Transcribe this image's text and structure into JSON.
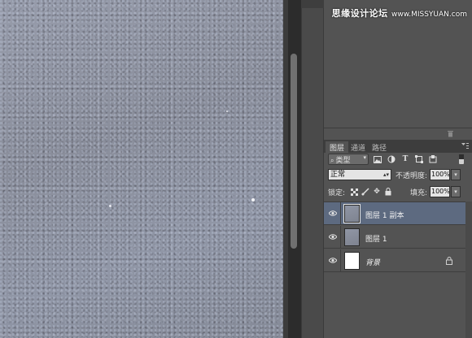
{
  "watermark": {
    "site_name": "思缘设计论坛",
    "url": "www.MISSYUAN.com"
  },
  "canvas": {
    "description": "gray-blue concrete texture"
  },
  "layers_panel": {
    "tabs": [
      "图层",
      "通道",
      "路径"
    ],
    "active_tab_index": 0,
    "filter": {
      "kind_label": "类型",
      "icons": [
        "image-filter-icon",
        "adjustment-filter-icon",
        "type-filter-icon",
        "shape-filter-icon",
        "smart-object-filter-icon"
      ]
    },
    "blend_mode": "正常",
    "opacity_label": "不透明度:",
    "opacity_value": "100%",
    "lock_label": "锁定:",
    "fill_label": "填充:",
    "fill_value": "100%",
    "layers": [
      {
        "name": "图层 1 副本",
        "visible": true,
        "selected": true,
        "thumbnail": "texture",
        "locked": false
      },
      {
        "name": "图层 1",
        "visible": true,
        "selected": false,
        "thumbnail": "texture",
        "locked": false
      },
      {
        "name": "背景",
        "visible": true,
        "selected": false,
        "thumbnail": "white",
        "locked": true
      }
    ]
  },
  "colors": {
    "panel_bg": "#535353",
    "selected_layer": "#5d6a80",
    "canvas_texture": "#8a8f9c"
  }
}
